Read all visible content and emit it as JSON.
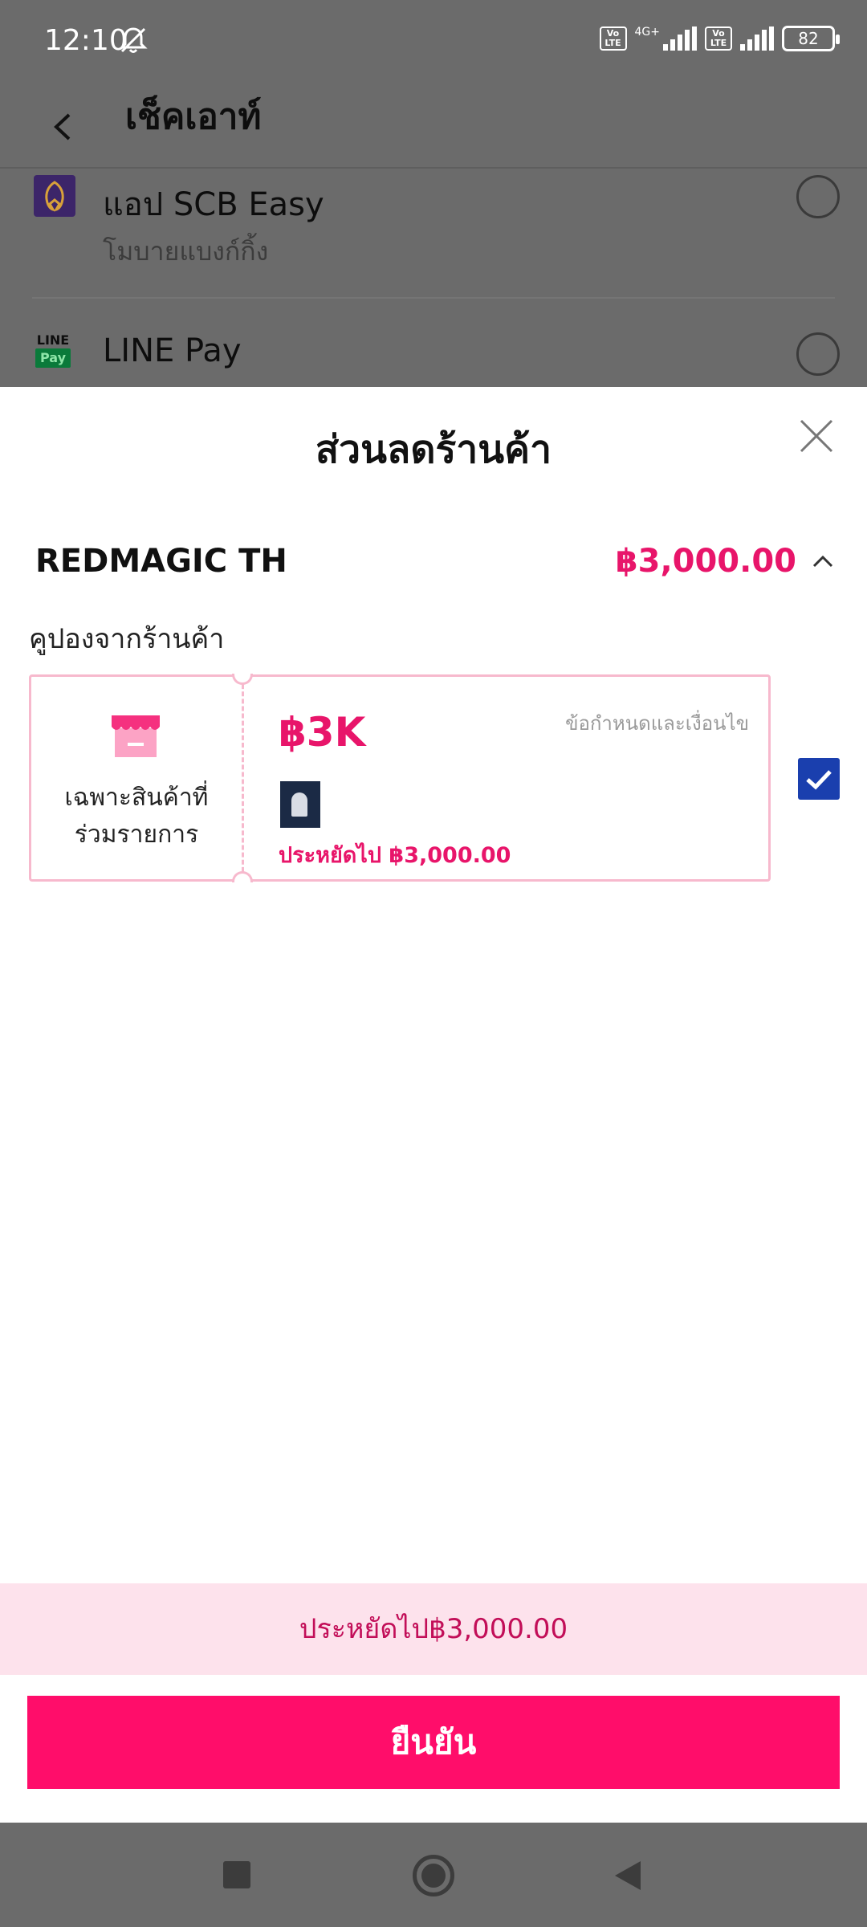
{
  "status_bar": {
    "time": "12:10",
    "volte_1": "Vo LTE",
    "network_tag": "4G+",
    "volte_2": "Vo LTE",
    "battery": "82"
  },
  "header": {
    "title": "เช็คเอาท์"
  },
  "payment_methods": [
    {
      "name": "แอป SCB Easy",
      "subtitle": "โมบายแบงก์กิ้ง"
    },
    {
      "name": "LINE Pay",
      "logo_top": "LINE",
      "logo_bottom": "Pay"
    }
  ],
  "sheet": {
    "title": "ส่วนลดร้านค้า",
    "shop_name": "REDMAGIC TH",
    "shop_amount": "฿3,000.00",
    "section_label": "คูปองจากร้านค้า",
    "coupon": {
      "left_label_line1": "เฉพาะสินค้าที่",
      "left_label_line2": "ร่วมรายการ",
      "value": "฿3K",
      "terms": "ข้อกำหนดและเงื่อนไข",
      "saving": "ประหยัดไป ฿3,000.00",
      "selected": true
    },
    "savings_summary": "ประหยัดไป฿3,000.00",
    "confirm_label": "ยืนยัน"
  },
  "colors": {
    "accent": "#ff0d6a",
    "price": "#e8156a",
    "checkbox": "#1a3fae",
    "savings_bg": "#fde2ec",
    "overlay": "#6b6b6b"
  },
  "icons": [
    "bell-off-icon",
    "back-icon",
    "radio-icon",
    "close-icon",
    "chevron-up-icon",
    "shop-icon",
    "check-icon",
    "nav-recent-icon",
    "nav-home-icon",
    "nav-back-icon"
  ]
}
